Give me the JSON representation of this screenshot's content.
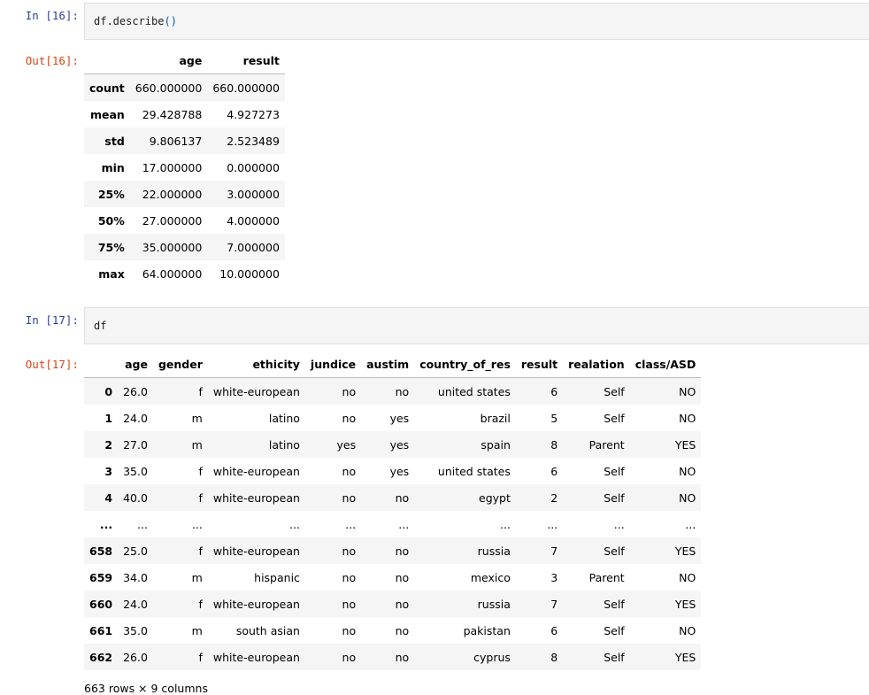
{
  "cells": [
    {
      "in_prompt": "In [16]:",
      "code_name": "df.describe",
      "code_paren": "()",
      "out_prompt": "Out[16]:",
      "table": {
        "columns": [
          "",
          "age",
          "result"
        ],
        "rows": [
          {
            "index": "count",
            "values": [
              "660.000000",
              "660.000000"
            ]
          },
          {
            "index": "mean",
            "values": [
              "29.428788",
              "4.927273"
            ]
          },
          {
            "index": "std",
            "values": [
              "9.806137",
              "2.523489"
            ]
          },
          {
            "index": "min",
            "values": [
              "17.000000",
              "0.000000"
            ]
          },
          {
            "index": "25%",
            "values": [
              "22.000000",
              "3.000000"
            ]
          },
          {
            "index": "50%",
            "values": [
              "27.000000",
              "4.000000"
            ]
          },
          {
            "index": "75%",
            "values": [
              "35.000000",
              "7.000000"
            ]
          },
          {
            "index": "max",
            "values": [
              "64.000000",
              "10.000000"
            ]
          }
        ]
      }
    },
    {
      "in_prompt": "In [17]:",
      "code": "df",
      "out_prompt": "Out[17]:",
      "table": {
        "columns": [
          "",
          "age",
          "gender",
          "ethicity",
          "jundice",
          "austim",
          "country_of_res",
          "result",
          "realation",
          "class/ASD"
        ],
        "rows": [
          {
            "index": "0",
            "values": [
              "26.0",
              "f",
              "white-european",
              "no",
              "no",
              "united states",
              "6",
              "Self",
              "NO"
            ]
          },
          {
            "index": "1",
            "values": [
              "24.0",
              "m",
              "latino",
              "no",
              "yes",
              "brazil",
              "5",
              "Self",
              "NO"
            ]
          },
          {
            "index": "2",
            "values": [
              "27.0",
              "m",
              "latino",
              "yes",
              "yes",
              "spain",
              "8",
              "Parent",
              "YES"
            ]
          },
          {
            "index": "3",
            "values": [
              "35.0",
              "f",
              "white-european",
              "no",
              "yes",
              "united states",
              "6",
              "Self",
              "NO"
            ]
          },
          {
            "index": "4",
            "values": [
              "40.0",
              "f",
              "white-european",
              "no",
              "no",
              "egypt",
              "2",
              "Self",
              "NO"
            ]
          },
          {
            "index": "...",
            "values": [
              "...",
              "...",
              "...",
              "...",
              "...",
              "...",
              "...",
              "...",
              "..."
            ]
          },
          {
            "index": "658",
            "values": [
              "25.0",
              "f",
              "white-european",
              "no",
              "no",
              "russia",
              "7",
              "Self",
              "YES"
            ]
          },
          {
            "index": "659",
            "values": [
              "34.0",
              "m",
              "hispanic",
              "no",
              "no",
              "mexico",
              "3",
              "Parent",
              "NO"
            ]
          },
          {
            "index": "660",
            "values": [
              "24.0",
              "f",
              "white-european",
              "no",
              "no",
              "russia",
              "7",
              "Self",
              "YES"
            ]
          },
          {
            "index": "661",
            "values": [
              "35.0",
              "m",
              "south asian",
              "no",
              "no",
              "pakistan",
              "6",
              "Self",
              "NO"
            ]
          },
          {
            "index": "662",
            "values": [
              "26.0",
              "f",
              "white-european",
              "no",
              "no",
              "cyprus",
              "8",
              "Self",
              "YES"
            ]
          }
        ]
      },
      "footer": "663 rows × 9 columns"
    }
  ]
}
